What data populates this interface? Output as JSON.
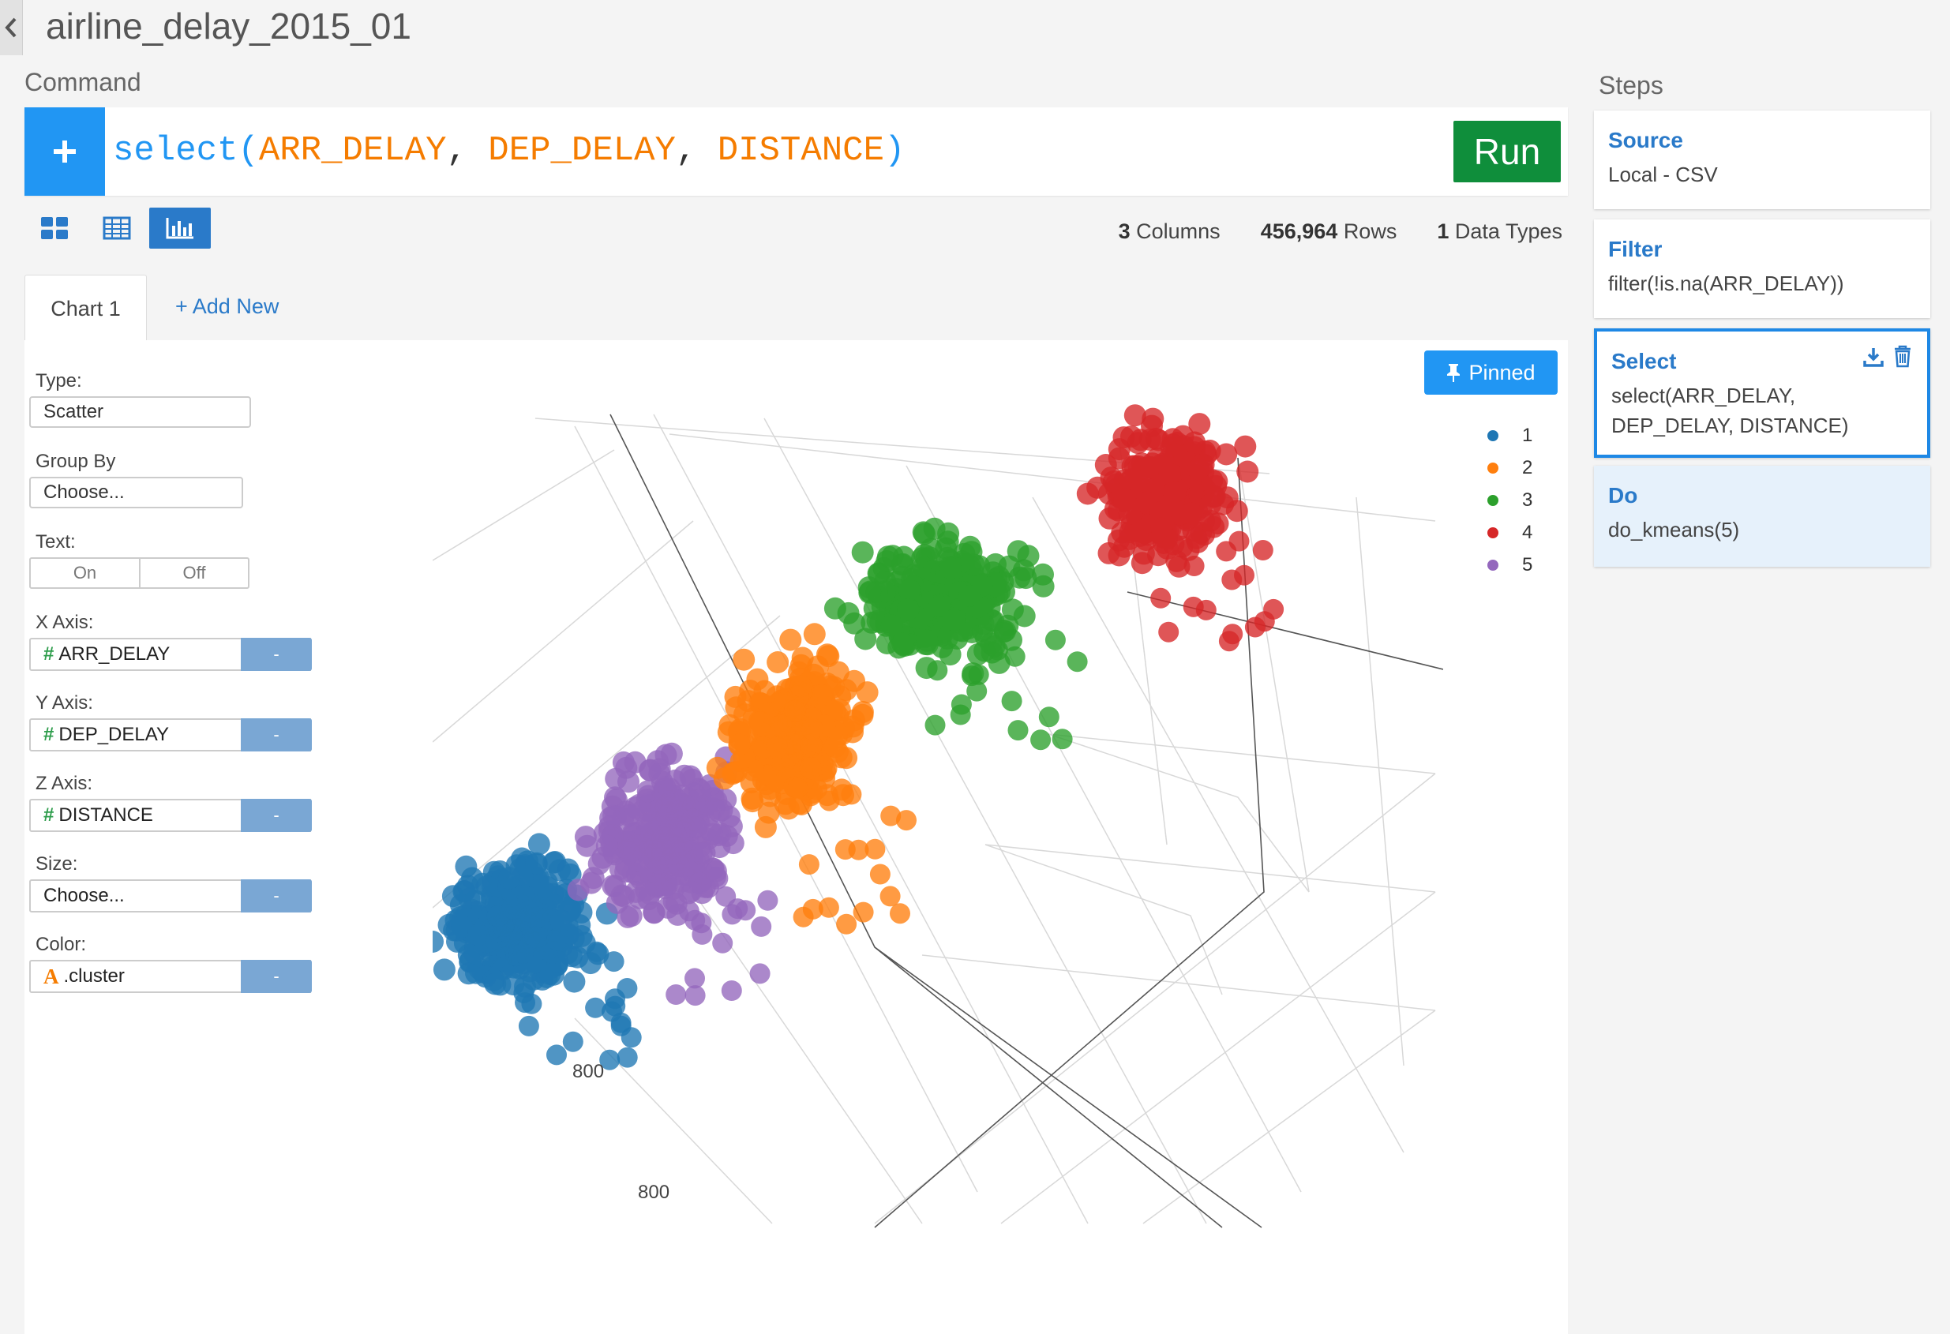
{
  "title": "airline_delay_2015_01",
  "command": {
    "label": "Command",
    "fn": "select(",
    "args": [
      "ARR_DELAY",
      "DEP_DELAY",
      "DISTANCE"
    ],
    "close": ")",
    "run_label": "Run"
  },
  "stats": {
    "columns_count": "3",
    "columns_label": "Columns",
    "rows_count": "456,964",
    "rows_label": "Rows",
    "types_count": "1",
    "types_label": "Data Types"
  },
  "tabs": {
    "chart1": "Chart 1",
    "add_new": "+ Add New"
  },
  "config": {
    "type_label": "Type:",
    "type_value": "Scatter",
    "group_label": "Group By",
    "group_value": "Choose...",
    "text_label": "Text:",
    "text_on": "On",
    "text_off": "Off",
    "x_label": "X Axis:",
    "x_value": "ARR_DELAY",
    "y_label": "Y Axis:",
    "y_value": "DEP_DELAY",
    "z_label": "Z Axis:",
    "z_value": "DISTANCE",
    "size_label": "Size:",
    "size_value": "Choose...",
    "color_label": "Color:",
    "color_value": ".cluster",
    "axis_button": "-"
  },
  "pinned_label": "Pinned",
  "chart_data": {
    "type": "scatter",
    "dimensions": 3,
    "x_axis": "ARR_DELAY",
    "y_axis": "DEP_DELAY",
    "z_axis": "DISTANCE",
    "color_by": ".cluster",
    "tick_labels": [
      "800",
      "800"
    ],
    "legend": [
      "1",
      "2",
      "3",
      "4",
      "5"
    ],
    "series_colors": [
      "#1f77b4",
      "#ff7f0e",
      "#2ca02c",
      "#d62728",
      "#9467bd"
    ]
  },
  "steps": {
    "label": "Steps",
    "items": [
      {
        "title": "Source",
        "desc": "Local - CSV"
      },
      {
        "title": "Filter",
        "desc": "filter(!is.na(ARR_DELAY))"
      },
      {
        "title": "Select",
        "desc": "select(ARR_DELAY, DEP_DELAY, DISTANCE)"
      },
      {
        "title": "Do",
        "desc": "do_kmeans(5)"
      }
    ]
  }
}
